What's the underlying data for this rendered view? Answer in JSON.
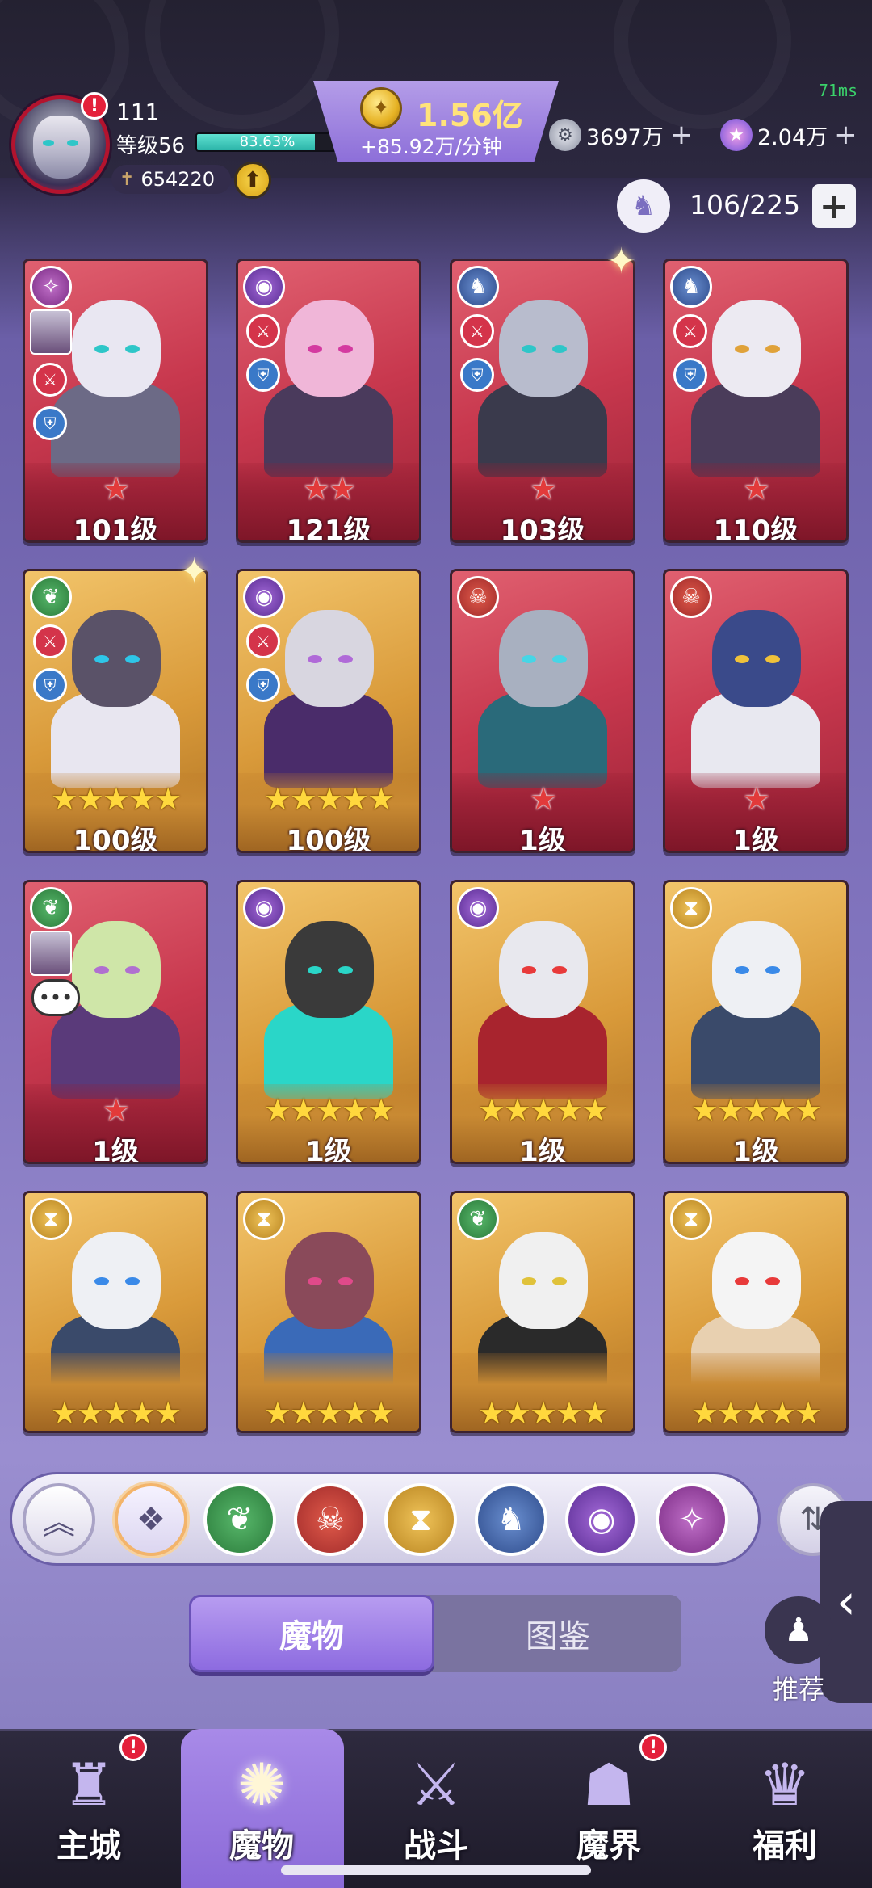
{
  "status": {
    "ping": "71ms"
  },
  "player": {
    "name": "111",
    "level_text": "等级56",
    "xp_percent_text": "83.63%",
    "xp_fraction": 0.8363,
    "power": "654220",
    "avatar_alert": "!"
  },
  "currency": {
    "gold_value": "1.56亿",
    "gold_rate": "+85.92万/分钟",
    "silver_value": "3697万",
    "crystal_value": "2.04万",
    "plus_symbol": "+"
  },
  "roster": {
    "count": "106/225",
    "add_symbol": "+"
  },
  "cards": [
    {
      "level": "101级",
      "frame": "red",
      "stars": "★",
      "element": "chaos",
      "badges": [
        "atk",
        "def"
      ],
      "portrait": true
    },
    {
      "level": "121级",
      "frame": "red",
      "stars": "★★",
      "element": "eye",
      "badges": [
        "atk",
        "def"
      ]
    },
    {
      "level": "103级",
      "frame": "red",
      "stars": "★",
      "element": "dragon",
      "badges": [
        "atk",
        "def"
      ],
      "sparkle": true
    },
    {
      "level": "110级",
      "frame": "red",
      "stars": "★",
      "element": "dragon",
      "badges": [
        "atk",
        "def"
      ]
    },
    {
      "level": "100级",
      "frame": "gold",
      "stars": "★★★★★",
      "element": "nature",
      "badges": [
        "atk",
        "def"
      ],
      "sparkle": true
    },
    {
      "level": "100级",
      "frame": "gold",
      "stars": "★★★★★",
      "element": "eye",
      "badges": [
        "atk",
        "def"
      ]
    },
    {
      "level": "1级",
      "frame": "red",
      "stars": "★",
      "element": "demon",
      "badges": []
    },
    {
      "level": "1级",
      "frame": "red",
      "stars": "★",
      "element": "demon",
      "badges": []
    },
    {
      "level": "1级",
      "frame": "red",
      "stars": "★",
      "element": "nature",
      "badges": [],
      "portrait": true,
      "chat": true
    },
    {
      "level": "1级",
      "frame": "gold",
      "stars": "★★★★★",
      "element": "eye",
      "badges": []
    },
    {
      "level": "1级",
      "frame": "gold",
      "stars": "★★★★★",
      "element": "eye",
      "badges": []
    },
    {
      "level": "1级",
      "frame": "gold",
      "stars": "★★★★★",
      "element": "time",
      "badges": []
    },
    {
      "level": "",
      "frame": "gold",
      "stars": "★★★★★",
      "element": "time",
      "badges": []
    },
    {
      "level": "",
      "frame": "gold",
      "stars": "★★★★★",
      "element": "time",
      "badges": []
    },
    {
      "level": "",
      "frame": "gold",
      "stars": "★★★★★",
      "element": "nature",
      "badges": []
    },
    {
      "level": "",
      "frame": "gold",
      "stars": "★★★★★",
      "element": "time",
      "badges": []
    }
  ],
  "filters": [
    "collapse",
    "all",
    "nature",
    "demon",
    "time",
    "dragon",
    "eye",
    "chaos"
  ],
  "tabs": {
    "monsters": "魔物",
    "codex": "图鉴"
  },
  "recommend": {
    "label": "推荐"
  },
  "nav": [
    {
      "label": "主城",
      "icon": "castle-icon",
      "alert": "!"
    },
    {
      "label": "魔物",
      "icon": "monster-flame-icon",
      "active": true
    },
    {
      "label": "战斗",
      "icon": "sword-shield-icon"
    },
    {
      "label": "魔界",
      "icon": "portal-icon",
      "alert": "!"
    },
    {
      "label": "福利",
      "icon": "treasure-chest-icon"
    }
  ],
  "colors": {
    "accent": "#8d6be0",
    "red_frame": "#c8384e",
    "gold_frame": "#d99a3a",
    "gold_text": "#ffe37a"
  }
}
